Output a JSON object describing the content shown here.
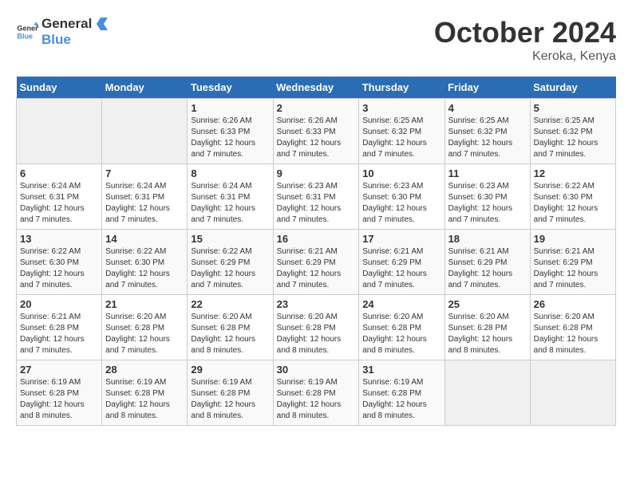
{
  "logo": {
    "line1": "General",
    "line2": "Blue"
  },
  "title": "October 2024",
  "location": "Keroka, Kenya",
  "days_header": [
    "Sunday",
    "Monday",
    "Tuesday",
    "Wednesday",
    "Thursday",
    "Friday",
    "Saturday"
  ],
  "weeks": [
    [
      {
        "num": "",
        "info": ""
      },
      {
        "num": "",
        "info": ""
      },
      {
        "num": "1",
        "info": "Sunrise: 6:26 AM\nSunset: 6:33 PM\nDaylight: 12 hours and 7 minutes."
      },
      {
        "num": "2",
        "info": "Sunrise: 6:26 AM\nSunset: 6:33 PM\nDaylight: 12 hours and 7 minutes."
      },
      {
        "num": "3",
        "info": "Sunrise: 6:25 AM\nSunset: 6:32 PM\nDaylight: 12 hours and 7 minutes."
      },
      {
        "num": "4",
        "info": "Sunrise: 6:25 AM\nSunset: 6:32 PM\nDaylight: 12 hours and 7 minutes."
      },
      {
        "num": "5",
        "info": "Sunrise: 6:25 AM\nSunset: 6:32 PM\nDaylight: 12 hours and 7 minutes."
      }
    ],
    [
      {
        "num": "6",
        "info": "Sunrise: 6:24 AM\nSunset: 6:31 PM\nDaylight: 12 hours and 7 minutes."
      },
      {
        "num": "7",
        "info": "Sunrise: 6:24 AM\nSunset: 6:31 PM\nDaylight: 12 hours and 7 minutes."
      },
      {
        "num": "8",
        "info": "Sunrise: 6:24 AM\nSunset: 6:31 PM\nDaylight: 12 hours and 7 minutes."
      },
      {
        "num": "9",
        "info": "Sunrise: 6:23 AM\nSunset: 6:31 PM\nDaylight: 12 hours and 7 minutes."
      },
      {
        "num": "10",
        "info": "Sunrise: 6:23 AM\nSunset: 6:30 PM\nDaylight: 12 hours and 7 minutes."
      },
      {
        "num": "11",
        "info": "Sunrise: 6:23 AM\nSunset: 6:30 PM\nDaylight: 12 hours and 7 minutes."
      },
      {
        "num": "12",
        "info": "Sunrise: 6:22 AM\nSunset: 6:30 PM\nDaylight: 12 hours and 7 minutes."
      }
    ],
    [
      {
        "num": "13",
        "info": "Sunrise: 6:22 AM\nSunset: 6:30 PM\nDaylight: 12 hours and 7 minutes."
      },
      {
        "num": "14",
        "info": "Sunrise: 6:22 AM\nSunset: 6:30 PM\nDaylight: 12 hours and 7 minutes."
      },
      {
        "num": "15",
        "info": "Sunrise: 6:22 AM\nSunset: 6:29 PM\nDaylight: 12 hours and 7 minutes."
      },
      {
        "num": "16",
        "info": "Sunrise: 6:21 AM\nSunset: 6:29 PM\nDaylight: 12 hours and 7 minutes."
      },
      {
        "num": "17",
        "info": "Sunrise: 6:21 AM\nSunset: 6:29 PM\nDaylight: 12 hours and 7 minutes."
      },
      {
        "num": "18",
        "info": "Sunrise: 6:21 AM\nSunset: 6:29 PM\nDaylight: 12 hours and 7 minutes."
      },
      {
        "num": "19",
        "info": "Sunrise: 6:21 AM\nSunset: 6:29 PM\nDaylight: 12 hours and 7 minutes."
      }
    ],
    [
      {
        "num": "20",
        "info": "Sunrise: 6:21 AM\nSunset: 6:28 PM\nDaylight: 12 hours and 7 minutes."
      },
      {
        "num": "21",
        "info": "Sunrise: 6:20 AM\nSunset: 6:28 PM\nDaylight: 12 hours and 7 minutes."
      },
      {
        "num": "22",
        "info": "Sunrise: 6:20 AM\nSunset: 6:28 PM\nDaylight: 12 hours and 8 minutes."
      },
      {
        "num": "23",
        "info": "Sunrise: 6:20 AM\nSunset: 6:28 PM\nDaylight: 12 hours and 8 minutes."
      },
      {
        "num": "24",
        "info": "Sunrise: 6:20 AM\nSunset: 6:28 PM\nDaylight: 12 hours and 8 minutes."
      },
      {
        "num": "25",
        "info": "Sunrise: 6:20 AM\nSunset: 6:28 PM\nDaylight: 12 hours and 8 minutes."
      },
      {
        "num": "26",
        "info": "Sunrise: 6:20 AM\nSunset: 6:28 PM\nDaylight: 12 hours and 8 minutes."
      }
    ],
    [
      {
        "num": "27",
        "info": "Sunrise: 6:19 AM\nSunset: 6:28 PM\nDaylight: 12 hours and 8 minutes."
      },
      {
        "num": "28",
        "info": "Sunrise: 6:19 AM\nSunset: 6:28 PM\nDaylight: 12 hours and 8 minutes."
      },
      {
        "num": "29",
        "info": "Sunrise: 6:19 AM\nSunset: 6:28 PM\nDaylight: 12 hours and 8 minutes."
      },
      {
        "num": "30",
        "info": "Sunrise: 6:19 AM\nSunset: 6:28 PM\nDaylight: 12 hours and 8 minutes."
      },
      {
        "num": "31",
        "info": "Sunrise: 6:19 AM\nSunset: 6:28 PM\nDaylight: 12 hours and 8 minutes."
      },
      {
        "num": "",
        "info": ""
      },
      {
        "num": "",
        "info": ""
      }
    ]
  ]
}
